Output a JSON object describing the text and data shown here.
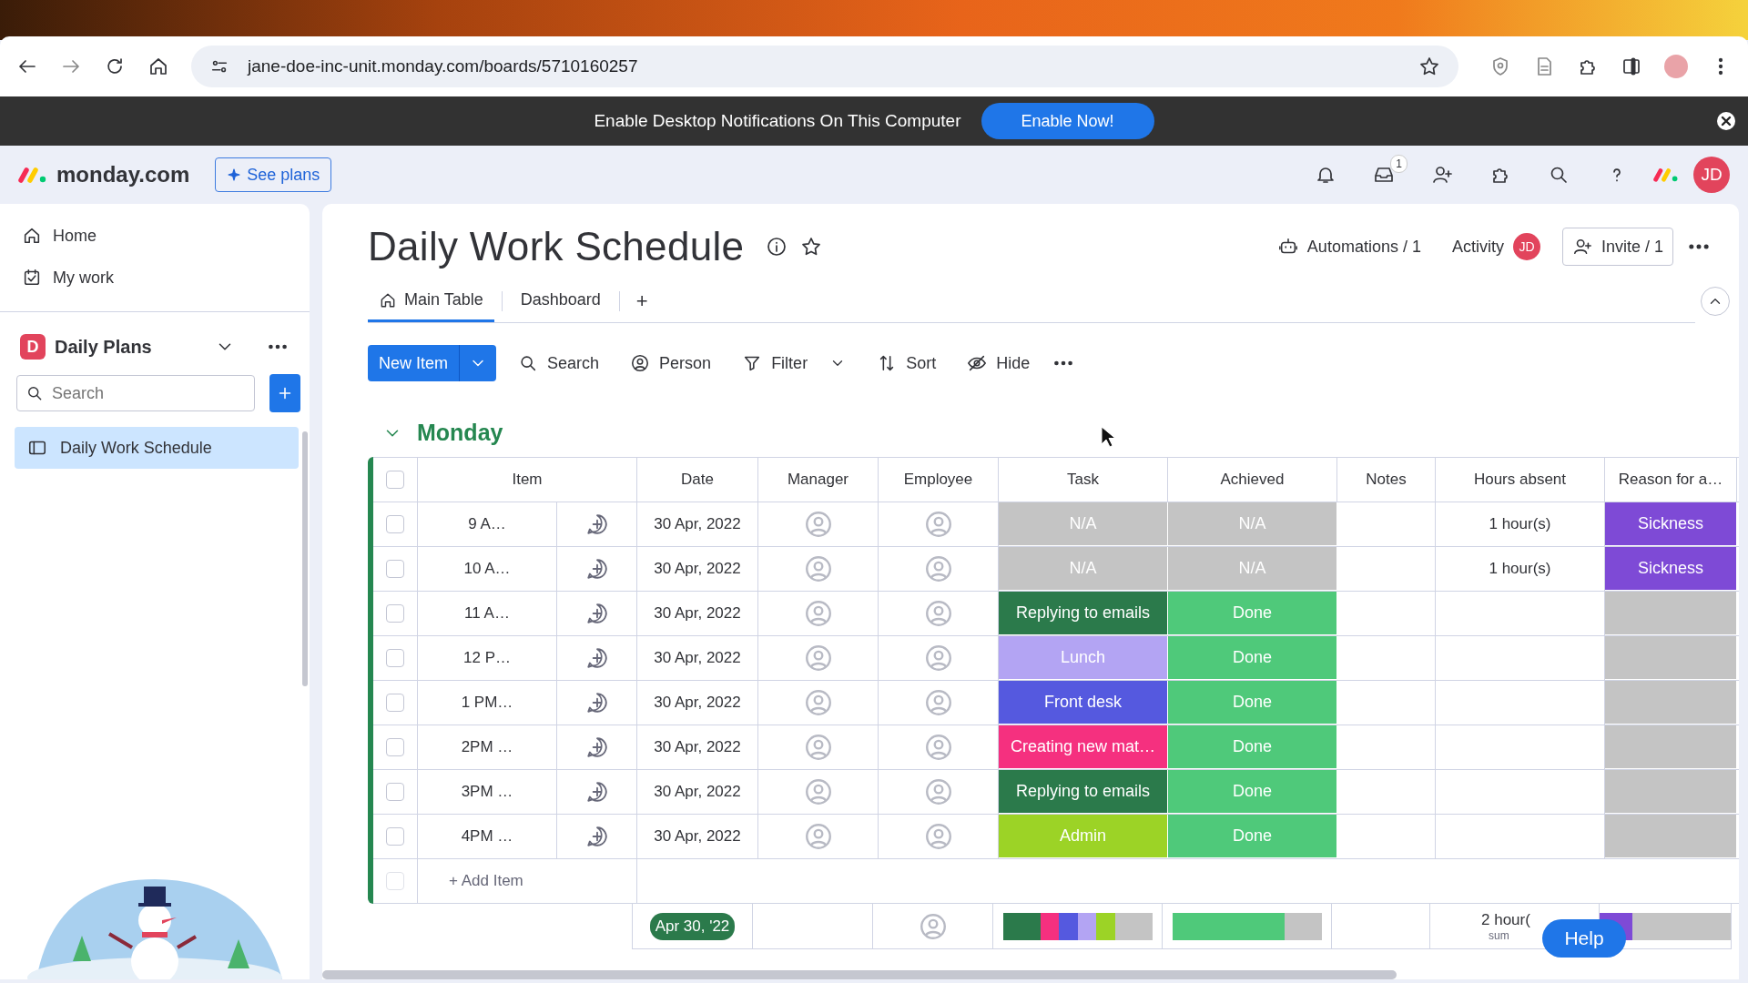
{
  "browser": {
    "url": "jane-doe-inc-unit.monday.com/boards/5710160257"
  },
  "notification": {
    "text": "Enable Desktop Notifications On This Computer",
    "button": "Enable Now!"
  },
  "app_header": {
    "logo": "monday.com",
    "see_plans": "See plans",
    "inbox_badge": "1",
    "avatar": "JD"
  },
  "sidebar": {
    "nav": [
      {
        "label": "Home",
        "kind": "home"
      },
      {
        "label": "My work",
        "kind": "calendar"
      }
    ],
    "workspace": {
      "badge": "D",
      "name": "Daily Plans"
    },
    "search": {
      "placeholder": "Search"
    },
    "boards": [
      {
        "label": "Daily Work Schedule",
        "selected": true
      }
    ]
  },
  "board": {
    "title": "Daily Work Schedule",
    "automations": "Automations / 1",
    "activity": "Activity",
    "activity_avatar": "JD",
    "invite": "Invite / 1",
    "tabs": [
      {
        "label": "Main Table",
        "selected": true
      },
      {
        "label": "Dashboard",
        "selected": false
      }
    ],
    "add_tab": "+",
    "toolbar": {
      "new_item": "New Item",
      "actions": [
        {
          "label": "Search",
          "kind": "search"
        },
        {
          "label": "Person",
          "kind": "person"
        },
        {
          "label": "Filter",
          "kind": "filter"
        },
        {
          "label": "Sort",
          "kind": "sort"
        },
        {
          "label": "Hide",
          "kind": "hide"
        }
      ]
    }
  },
  "group": {
    "name": "Monday",
    "expanded": true,
    "columns": [
      "Item",
      "Date",
      "Manager",
      "Employee",
      "Task",
      "Achieved",
      "Notes",
      "Hours absent",
      "Reason for a…"
    ],
    "rows": [
      {
        "checked": false,
        "item": "9 A…",
        "date": "30 Apr, 2022",
        "task": {
          "label": "N/A",
          "color": "#c4c4c4"
        },
        "achieved": {
          "label": "N/A",
          "color": "#c4c4c4"
        },
        "hours": "1 hour(s)",
        "reason": {
          "label": "Sickness",
          "color": "#7e4ad6"
        }
      },
      {
        "checked": false,
        "item": "10 A…",
        "date": "30 Apr, 2022",
        "task": {
          "label": "N/A",
          "color": "#c4c4c4"
        },
        "achieved": {
          "label": "N/A",
          "color": "#c4c4c4"
        },
        "hours": "1 hour(s)",
        "reason": {
          "label": "Sickness",
          "color": "#7e4ad6"
        }
      },
      {
        "checked": false,
        "item": "11 A…",
        "date": "30 Apr, 2022",
        "task": {
          "label": "Replying to emails",
          "color": "#2b7a4b"
        },
        "achieved": {
          "label": "Done",
          "color": "#4fc97a"
        },
        "reason": {
          "color": "#c4c4c4"
        }
      },
      {
        "checked": false,
        "item": "12 P…",
        "date": "30 Apr, 2022",
        "task": {
          "label": "Lunch",
          "color": "#b3a4f3"
        },
        "achieved": {
          "label": "Done",
          "color": "#4fc97a"
        },
        "reason": {
          "color": "#c4c4c4"
        }
      },
      {
        "checked": false,
        "item": "1 PM…",
        "date": "30 Apr, 2022",
        "task": {
          "label": "Front desk",
          "color": "#5559df"
        },
        "achieved": {
          "label": "Done",
          "color": "#4fc97a"
        },
        "reason": {
          "color": "#c4c4c4"
        }
      },
      {
        "checked": false,
        "item": "2PM …",
        "date": "30 Apr, 2022",
        "task": {
          "label": "Creating new mat…",
          "color": "#f5307f"
        },
        "achieved": {
          "label": "Done",
          "color": "#4fc97a"
        },
        "reason": {
          "color": "#c4c4c4"
        }
      },
      {
        "checked": false,
        "item": "3PM …",
        "date": "30 Apr, 2022",
        "task": {
          "label": "Replying to emails",
          "color": "#2b7a4b"
        },
        "achieved": {
          "label": "Done",
          "color": "#4fc97a"
        },
        "reason": {
          "color": "#c4c4c4"
        }
      },
      {
        "checked": false,
        "item": "4PM …",
        "date": "30 Apr, 2022",
        "task": {
          "label": "Admin",
          "color": "#9cd326"
        },
        "achieved": {
          "label": "Done",
          "color": "#4fc97a"
        },
        "reason": {
          "color": "#c4c4c4"
        }
      }
    ],
    "all_checked": false,
    "add_item": {
      "label": "+ Add Item",
      "checked": false
    },
    "summary": {
      "date": "Apr 30, '22",
      "task": [
        {
          "color": "#2b7a4b"
        },
        {
          "color": "#2b7a4b"
        },
        {
          "color": "#f5307f"
        },
        {
          "color": "#5559df"
        },
        {
          "color": "#b3a4f3"
        },
        {
          "color": "#9cd326"
        },
        {
          "color": "#c4c4c4"
        },
        {
          "color": "#c4c4c4"
        }
      ],
      "achieved": [
        {
          "color": "#4fc97a"
        },
        {
          "color": "#4fc97a"
        },
        {
          "color": "#4fc97a"
        },
        {
          "color": "#4fc97a"
        },
        {
          "color": "#4fc97a"
        },
        {
          "color": "#4fc97a"
        },
        {
          "color": "#c4c4c4"
        },
        {
          "color": "#c4c4c4"
        }
      ],
      "hours": "2 hour(",
      "hours_note": "sum",
      "reason": [
        {
          "color": "#7e4ad6"
        },
        {
          "color": "#7e4ad6"
        },
        {
          "color": "#c4c4c4"
        },
        {
          "color": "#c4c4c4"
        },
        {
          "color": "#c4c4c4"
        },
        {
          "color": "#c4c4c4"
        },
        {
          "color": "#c4c4c4"
        },
        {
          "color": "#c4c4c4"
        }
      ]
    }
  },
  "help": "Help"
}
